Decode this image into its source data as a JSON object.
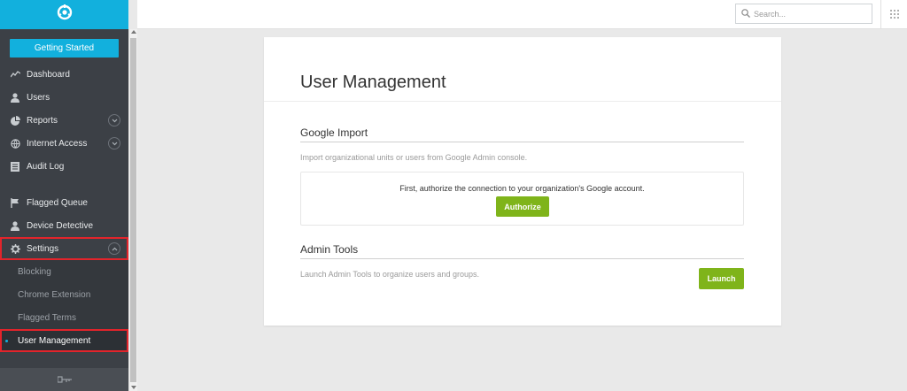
{
  "sidebar": {
    "logo": "shield-logo-icon",
    "getting_started": "Getting Started",
    "items": [
      {
        "label": "Dashboard",
        "icon": "activity-icon"
      },
      {
        "label": "Users",
        "icon": "user-icon"
      },
      {
        "label": "Reports",
        "icon": "pie-chart-icon"
      },
      {
        "label": "Internet Access",
        "icon": "globe-icon"
      },
      {
        "label": "Audit Log",
        "icon": "document-icon"
      },
      {
        "label": "Flagged Queue",
        "icon": "flag-icon"
      },
      {
        "label": "Device Detective",
        "icon": "user-icon"
      },
      {
        "label": "Settings",
        "icon": "gear-icon"
      }
    ],
    "settings_sub": [
      {
        "label": "Blocking"
      },
      {
        "label": "Chrome Extension"
      },
      {
        "label": "Flagged Terms"
      },
      {
        "label": "User Management"
      }
    ],
    "footer_icon": "collapse-handle-icon"
  },
  "topbar": {
    "search_placeholder": "Search...",
    "apps_icon": "grid-icon"
  },
  "main": {
    "title": "User Management",
    "google_import": {
      "title": "Google Import",
      "description": "Import organizational units or users from Google Admin console.",
      "message": "First, authorize the connection to your organization's Google account.",
      "button": "Authorize"
    },
    "admin_tools": {
      "title": "Admin Tools",
      "description": "Launch Admin Tools to organize users and groups.",
      "button": "Launch"
    }
  },
  "colors": {
    "brand": "#12b0dd",
    "sidebar": "#3c4046",
    "action_green": "#7fb41a",
    "highlight": "#e3242b"
  }
}
